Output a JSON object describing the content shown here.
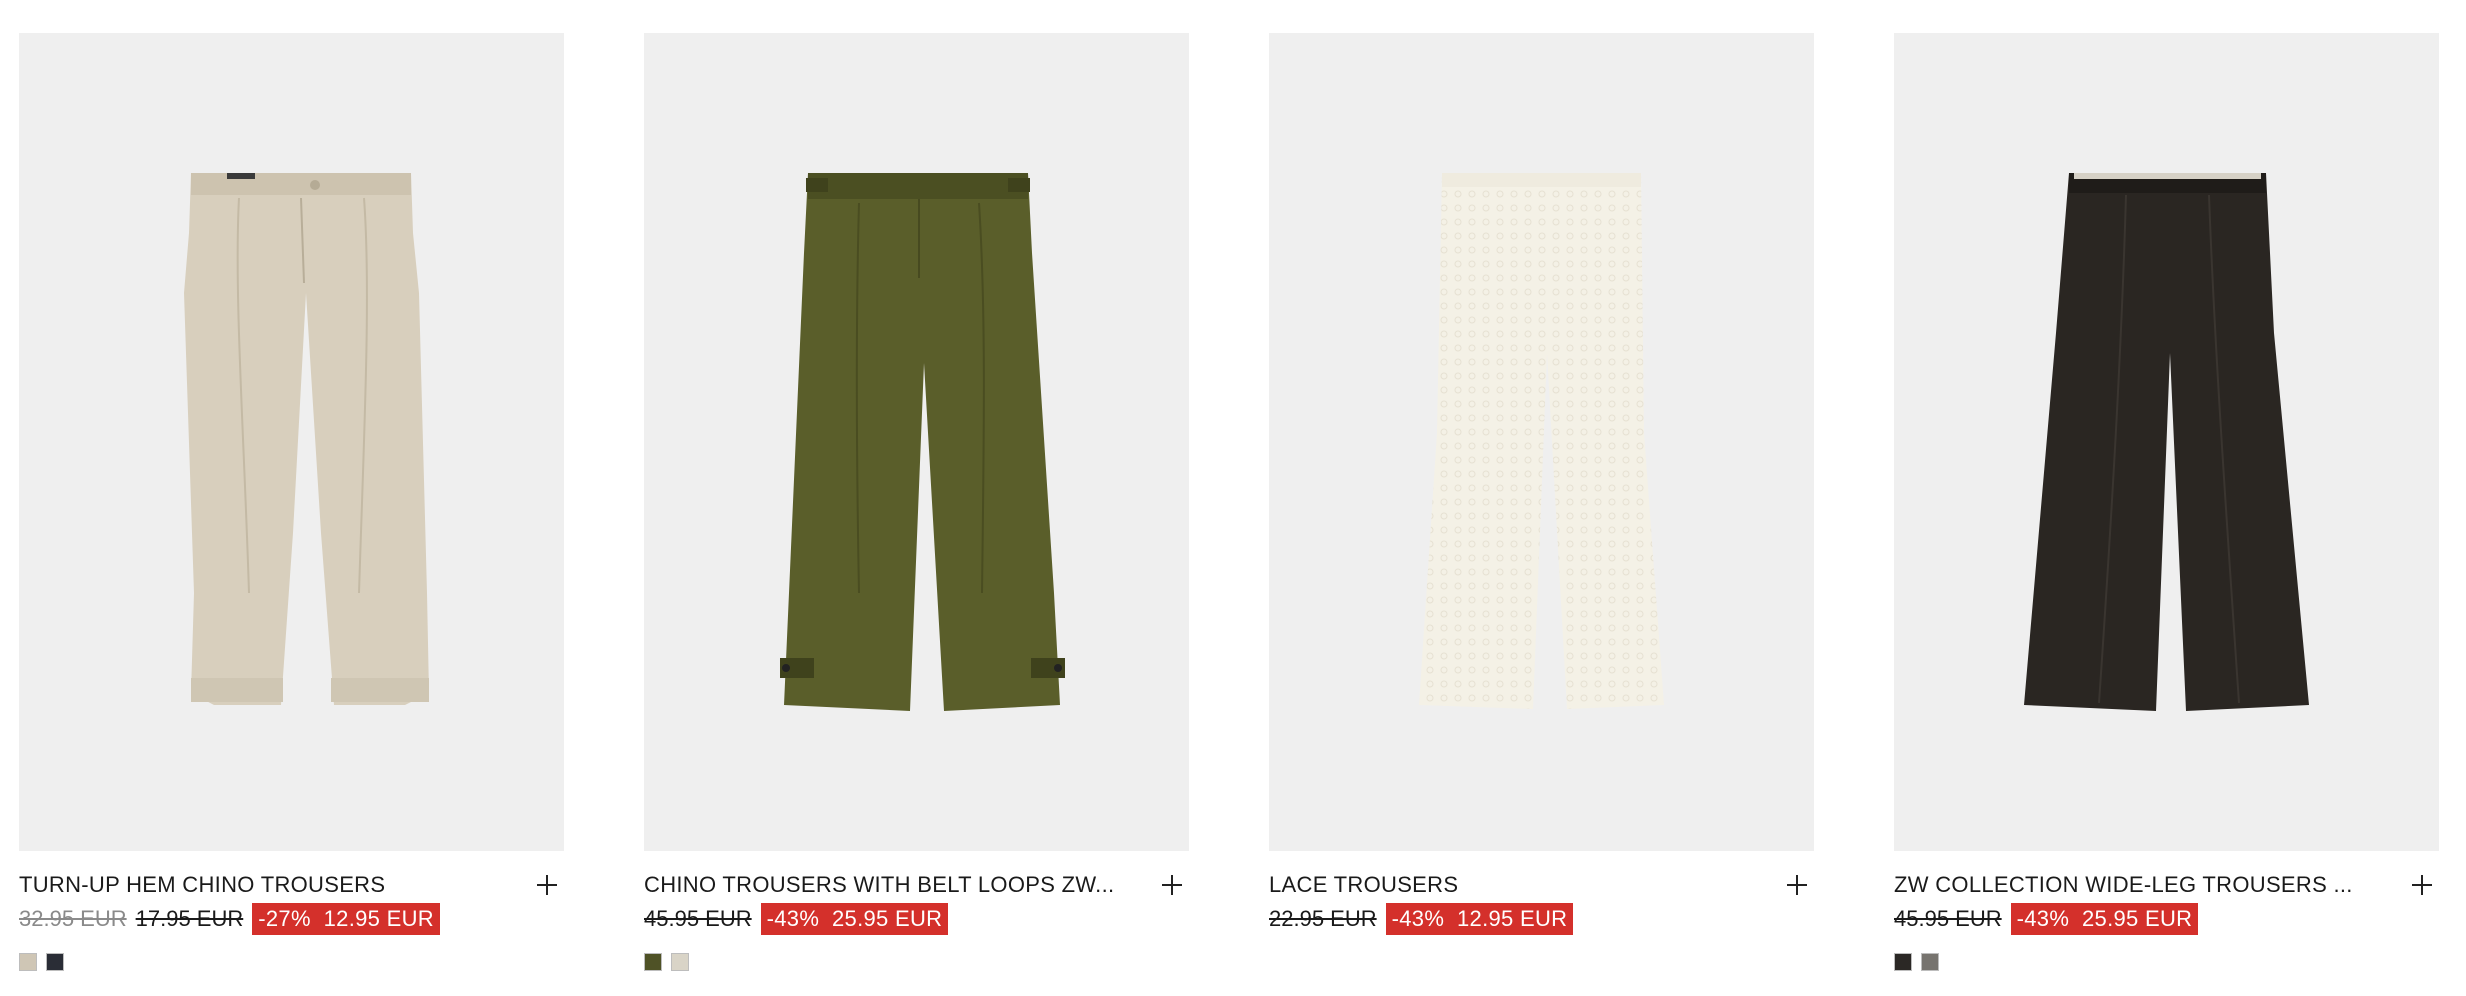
{
  "products": [
    {
      "name": "TURN-UP HEM CHINO TROUSERS",
      "original_price": "32.95 EUR",
      "previous_price": "17.95 EUR",
      "discount": "-27%",
      "sale_price": "12.95 EUR",
      "garment_color": "#d8cfbd",
      "swatches": [
        "#cfc6b5",
        "#2a2d36"
      ]
    },
    {
      "name": "CHINO TROUSERS WITH BELT LOOPS ZW...",
      "original_price": "45.95 EUR",
      "discount": "-43%",
      "sale_price": "25.95 EUR",
      "garment_color": "#5a5e2a",
      "swatches": [
        "#4f5226",
        "#d9d4c7"
      ]
    },
    {
      "name": "LACE TROUSERS",
      "original_price": "22.95 EUR",
      "discount": "-43%",
      "sale_price": "12.95 EUR",
      "garment_color": "#f4f1e6",
      "swatches": []
    },
    {
      "name": "ZW COLLECTION WIDE-LEG TROUSERS ...",
      "original_price": "45.95 EUR",
      "discount": "-43%",
      "sale_price": "25.95 EUR",
      "garment_color": "#2a2622",
      "swatches": [
        "#2b2825",
        "#77746f"
      ]
    }
  ],
  "colors": {
    "sale_badge": "#d4302b",
    "image_background": "#efefef"
  },
  "icons": {
    "add": "plus-icon"
  }
}
